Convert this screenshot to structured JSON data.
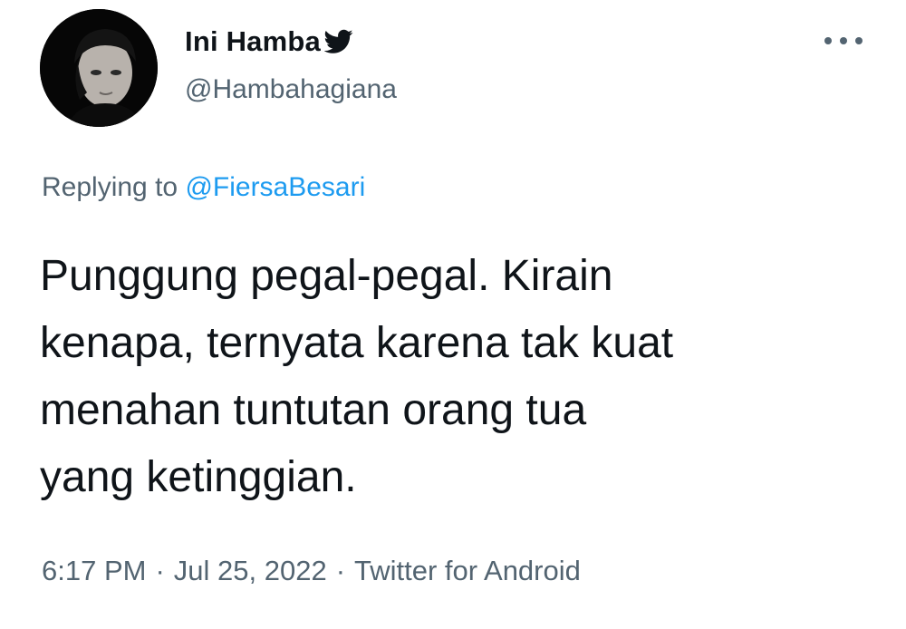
{
  "tweet": {
    "author": {
      "display_name": "Ini Hamba",
      "handle": "@Hambahagiana",
      "badge_icon": "twitter-bird-icon"
    },
    "more_icon": "more-options-icon",
    "reply": {
      "prefix": "Replying to",
      "mention": "@FiersaBesari"
    },
    "text": "Punggung pegal-pegal. Kirain\nkenapa, ternyata karena tak kuat\nmenahan tuntutan orang tua\nyang ketinggian.",
    "meta": {
      "time": "6:17 PM",
      "separator": "·",
      "date": "Jul 25, 2022",
      "source": "Twitter for Android"
    },
    "colors": {
      "text_primary": "#0f1419",
      "text_secondary": "#536471",
      "link": "#1d9bf0"
    }
  }
}
